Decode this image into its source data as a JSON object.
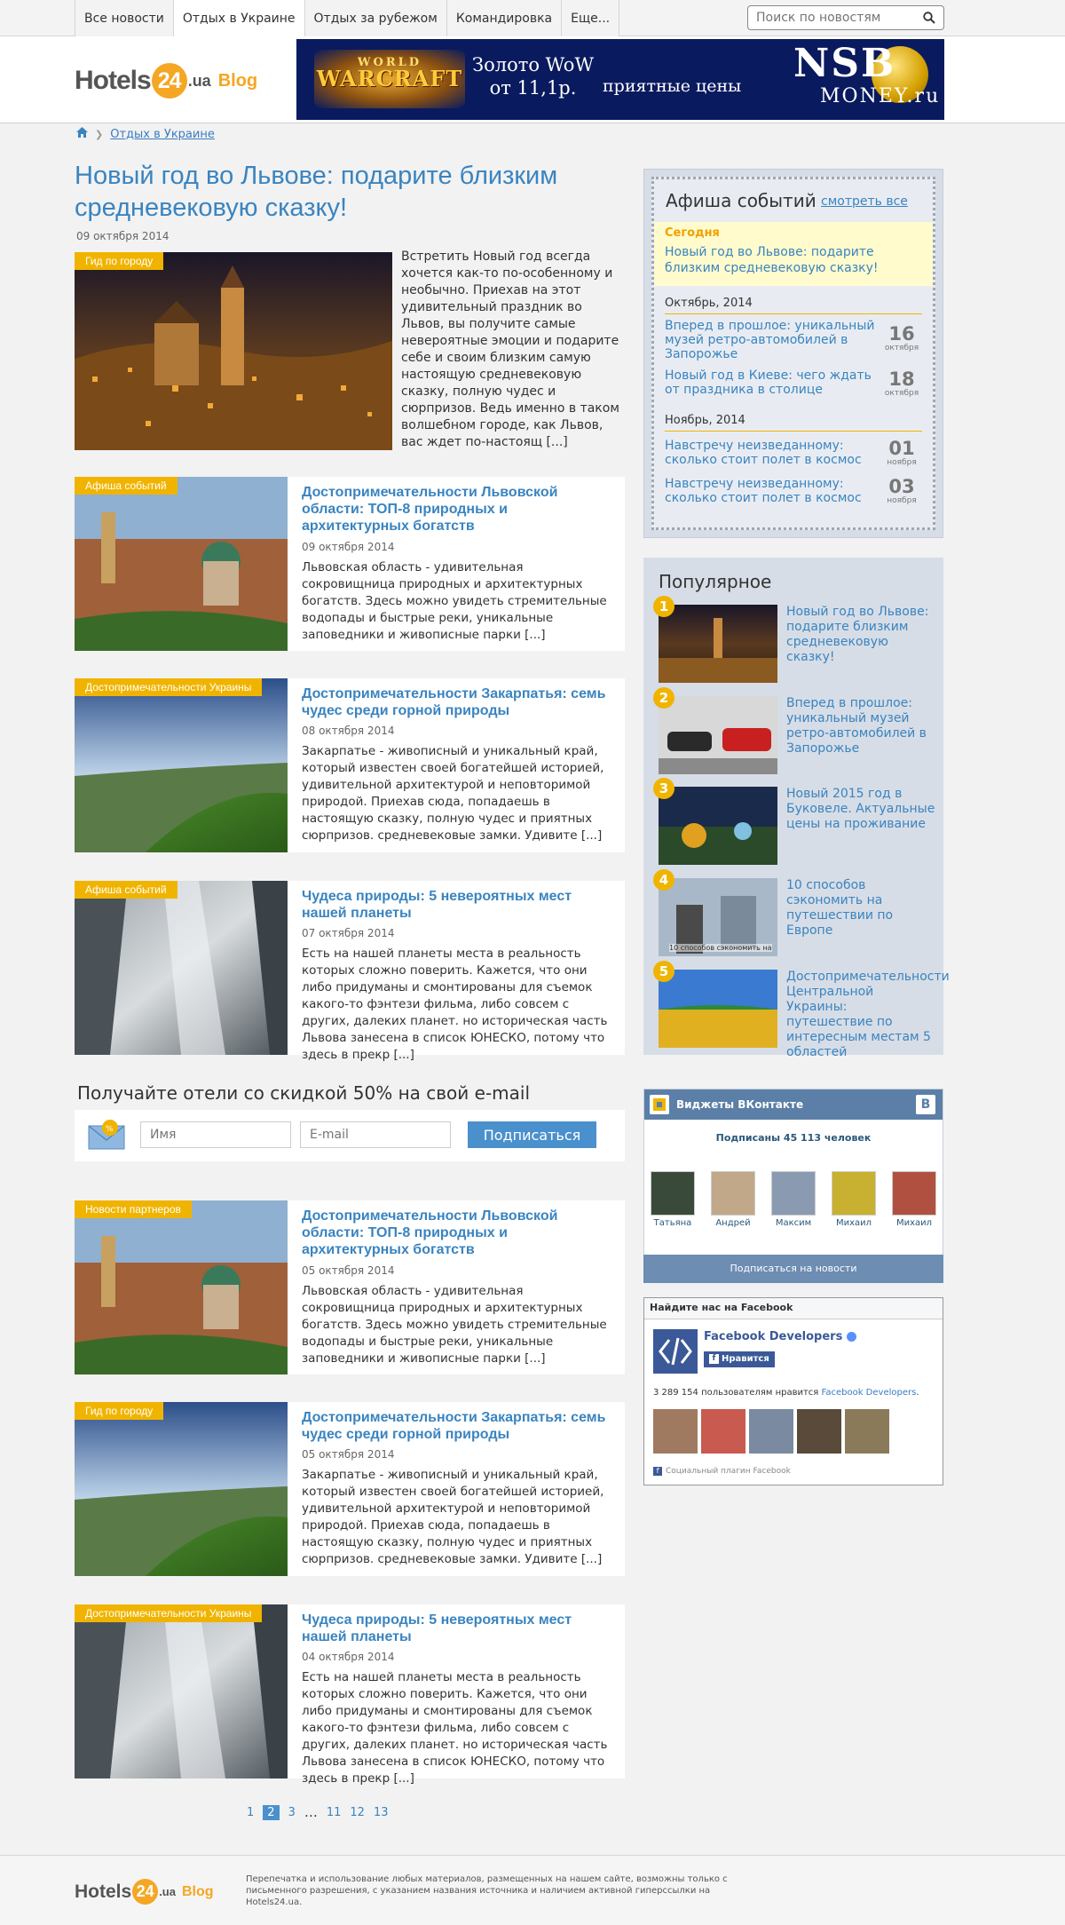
{
  "nav": {
    "tabs": [
      "Все новости",
      "Отдых в Украине",
      "Отдых за рубежом",
      "Командировка",
      "Еще..."
    ],
    "active": 1,
    "search_placeholder": "Поиск по новостям"
  },
  "logo": {
    "hotels": "Hotels",
    "num": "24",
    "ua": ".ua",
    "blog": "Blog"
  },
  "banner": {
    "world": "WORLD",
    "warcraft": "WARCRAFT",
    "line1": "Золото WoW",
    "line2": "от 11,1р.",
    "price": "приятные цены",
    "nsb": "NSB",
    "money": "MONEY.ru"
  },
  "breadcrumb": {
    "current": "Отдых в Украине"
  },
  "main": {
    "title": "Новый год во Львове: подарите близким средневековую сказку!",
    "date": "09 октября 2014",
    "tag": "Гид по городу",
    "excerpt": "Встретить Новый год всегда хочется как-то по-особенному и необычно. Приехав на этот удивительный праздник во Львов, вы получите самые невероятные эмоции и подарите себе и своим близким самую настоящую средневековую сказку, полную чудес и сюрпризов. Ведь именно в таком волшебном городе, как Львов, вас ждет по-настоящ [...]"
  },
  "articles": [
    {
      "tag": "Афиша событий",
      "title": "Достопримечательности Львовской области: ТОП-8 природных и архитектурных богатств",
      "date": "09 октября 2014",
      "excerpt": "Львовская область - удивительная сокровищница природных и архитектурных богатств. Здесь можно увидеть стремительные водопады и быстрые реки, уникальные заповедники и живописные парки [...]"
    },
    {
      "tag": "Достопримечательности Украины",
      "title": "Достопримечательности Закарпатья: семь чудес среди горной природы",
      "date": "08 октября 2014",
      "excerpt": "Закарпатье - живописный и уникальный край, который известен своей богатейшей историей, удивительной архитектурой и неповторимой природой. Приехав сюда, попадаешь в настоящую сказку, полную чудес и приятных сюрпризов. средневековые замки. Удивите [...]"
    },
    {
      "tag": "Афиша событий",
      "title": "Чудеса природы: 5 невероятных мест нашей планеты",
      "date": "07 октября 2014",
      "excerpt": "Есть на нашей планеты места в реальность которых сложно поверить. Кажется, что они либо придуманы и смонтированы для съемок какого-то фэнтези фильма, либо совсем с других, далеких планет. но историческая часть Львова занесена в список ЮНЕСКО, потому что здесь в прекр [...]"
    },
    {
      "tag": "Новости партнеров",
      "title": "Достопримечательности Львовской области: ТОП-8 природных и архитектурных богатств",
      "date": "05 октября 2014",
      "excerpt": "Львовская область - удивительная сокровищница природных и архитектурных богатств. Здесь можно увидеть стремительные водопады и быстрые реки, уникальные заповедники и живописные парки [...]"
    },
    {
      "tag": "Гид по городу",
      "title": "Достопримечательности Закарпатья: семь чудес среди горной природы",
      "date": "05 октября 2014",
      "excerpt": "Закарпатье - живописный и уникальный край, который известен своей богатейшей историей, удивительной архитектурой и неповторимой природой. Приехав сюда, попадаешь в настоящую сказку, полную чудес и приятных сюрпризов. средневековые замки. Удивите [...]"
    },
    {
      "tag": "Достопримечательности Украины",
      "title": "Чудеса природы: 5 невероятных мест нашей планеты",
      "date": "04 октября 2014",
      "excerpt": "Есть на нашей планеты места в реальность которых сложно поверить. Кажется, что они либо придуманы и смонтированы для съемок какого-то фэнтези фильма, либо совсем с других, далеких планет. но историческая часть Львова занесена в список ЮНЕСКО, потому что здесь в прекр [...]"
    }
  ],
  "subscribe": {
    "title": "Получайте отели со скидкой 50% на свой e-mail",
    "name_placeholder": "Имя",
    "email_placeholder": "E-mail",
    "button": "Подписаться"
  },
  "pagination": {
    "pages": [
      "1",
      "2",
      "3",
      "…",
      "11",
      "12",
      "13"
    ],
    "current": "2"
  },
  "footer": {
    "text": "Перепечатка и использование любых материалов, размещенных на нашем сайте, возможны только с письменного разрешения, с указанием названия источника и наличием активной гиперссылки на Hotels24.ua."
  },
  "afisha": {
    "title": "Афиша событий",
    "link": "смотреть все",
    "today_label": "Сегодня",
    "today_title": "Новый год во Львове: подарите близким средневековую сказку!",
    "months": [
      {
        "name": "Октябрь, 2014",
        "events": [
          {
            "title": "Вперед в прошлое: уникальный музей ретро-автомобилей в Запорожье",
            "day": "16",
            "month": "октября"
          },
          {
            "title": "Новый год в Киеве: чего ждать от праздника в столице",
            "day": "18",
            "month": "октября"
          }
        ]
      },
      {
        "name": "Ноябрь, 2014",
        "events": [
          {
            "title": "Навстречу неизведанному: сколько стоит полет в космос",
            "day": "01",
            "month": "ноября"
          },
          {
            "title": "Навстречу неизведанному: сколько стоит полет в космос",
            "day": "03",
            "month": "ноября"
          }
        ]
      }
    ]
  },
  "popular": {
    "title": "Популярное",
    "items": [
      {
        "num": "1",
        "title": "Новый год во Львове: подарите близким средневековую сказку!"
      },
      {
        "num": "2",
        "title": "Вперед в прошлое: уникальный музей ретро-автомобилей в Запорожье"
      },
      {
        "num": "3",
        "title": "Новый 2015 год в Буковеле. Актуальные цены на проживание"
      },
      {
        "num": "4",
        "title": "10 способов сэкономить на путешествии по Европе",
        "img_caption": "10 способов сэкономить на"
      },
      {
        "num": "5",
        "title": "Достопримечательности Центральной Украины: путешествие по интересным местам 5 областей"
      }
    ]
  },
  "vk": {
    "title": "Виджеты ВКонтакте",
    "badge": "В",
    "subscribers": "Подписаны 45 113 человек",
    "people": [
      "Татьяна",
      "Андрей",
      "Максим",
      "Михаил",
      "Михаил"
    ],
    "button": "Подписаться на новости"
  },
  "fb": {
    "header": "Найдите нас на Facebook",
    "name": "Facebook Developers",
    "like": "Нравится",
    "count_prefix": "3 289 154 пользователям нравится",
    "count_link": "Facebook Developers",
    "footer": "Социальный плагин Facebook"
  }
}
